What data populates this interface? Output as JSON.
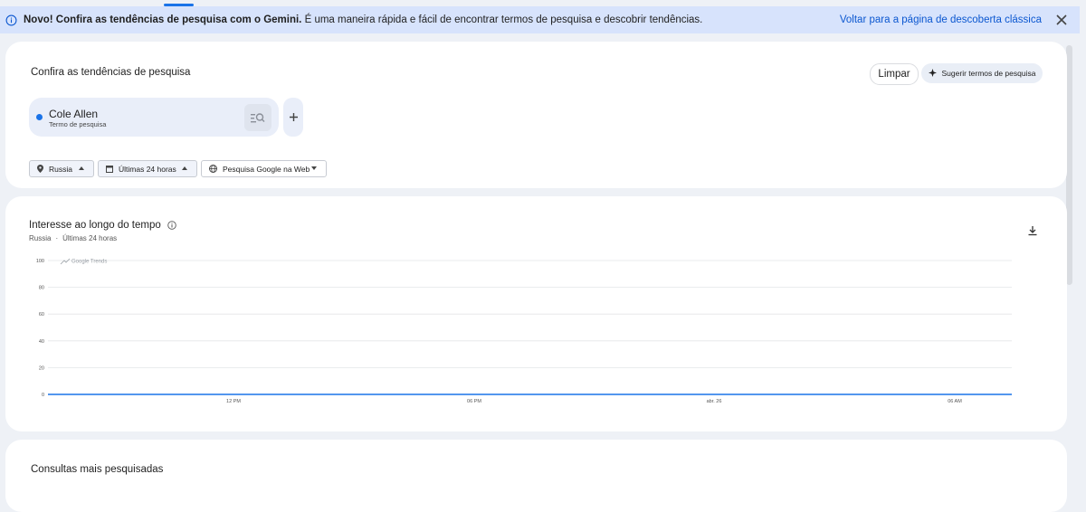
{
  "banner": {
    "bold_text": "Novo! Confira as tendências de pesquisa com o Gemini.",
    "text": " É uma maneira rápida e fácil de encontrar termos de pesquisa e descobrir tendências.",
    "link": "Voltar para a página de descoberta clássica"
  },
  "explore": {
    "title": "Confira as tendências de pesquisa",
    "clear_label": "Limpar",
    "suggest_label": "Sugerir termos de pesquisa",
    "term": {
      "name": "Cole Allen",
      "subtitle": "Termo de pesquisa",
      "color": "#1a73e8"
    },
    "filters": {
      "region": "Russia",
      "time": "Últimas 24 horas",
      "property": "Pesquisa Google na Web"
    }
  },
  "interest": {
    "title": "Interesse ao longo do tempo",
    "region": "Russia",
    "time": "Últimas 24 horas",
    "watermark": "Google Trends"
  },
  "chart_data": {
    "type": "line",
    "title": "",
    "ylim": [
      0,
      100
    ],
    "yticks": [
      "100",
      "80",
      "60",
      "40",
      "20",
      "0"
    ],
    "xticks": [
      "12 PM",
      "06 PM",
      "abr. 26",
      "06 AM"
    ],
    "series": [
      {
        "name": "Cole Allen",
        "values": [
          0,
          0,
          0,
          0,
          0
        ]
      }
    ],
    "grid": true
  },
  "related": {
    "title": "Consultas mais pesquisadas"
  }
}
